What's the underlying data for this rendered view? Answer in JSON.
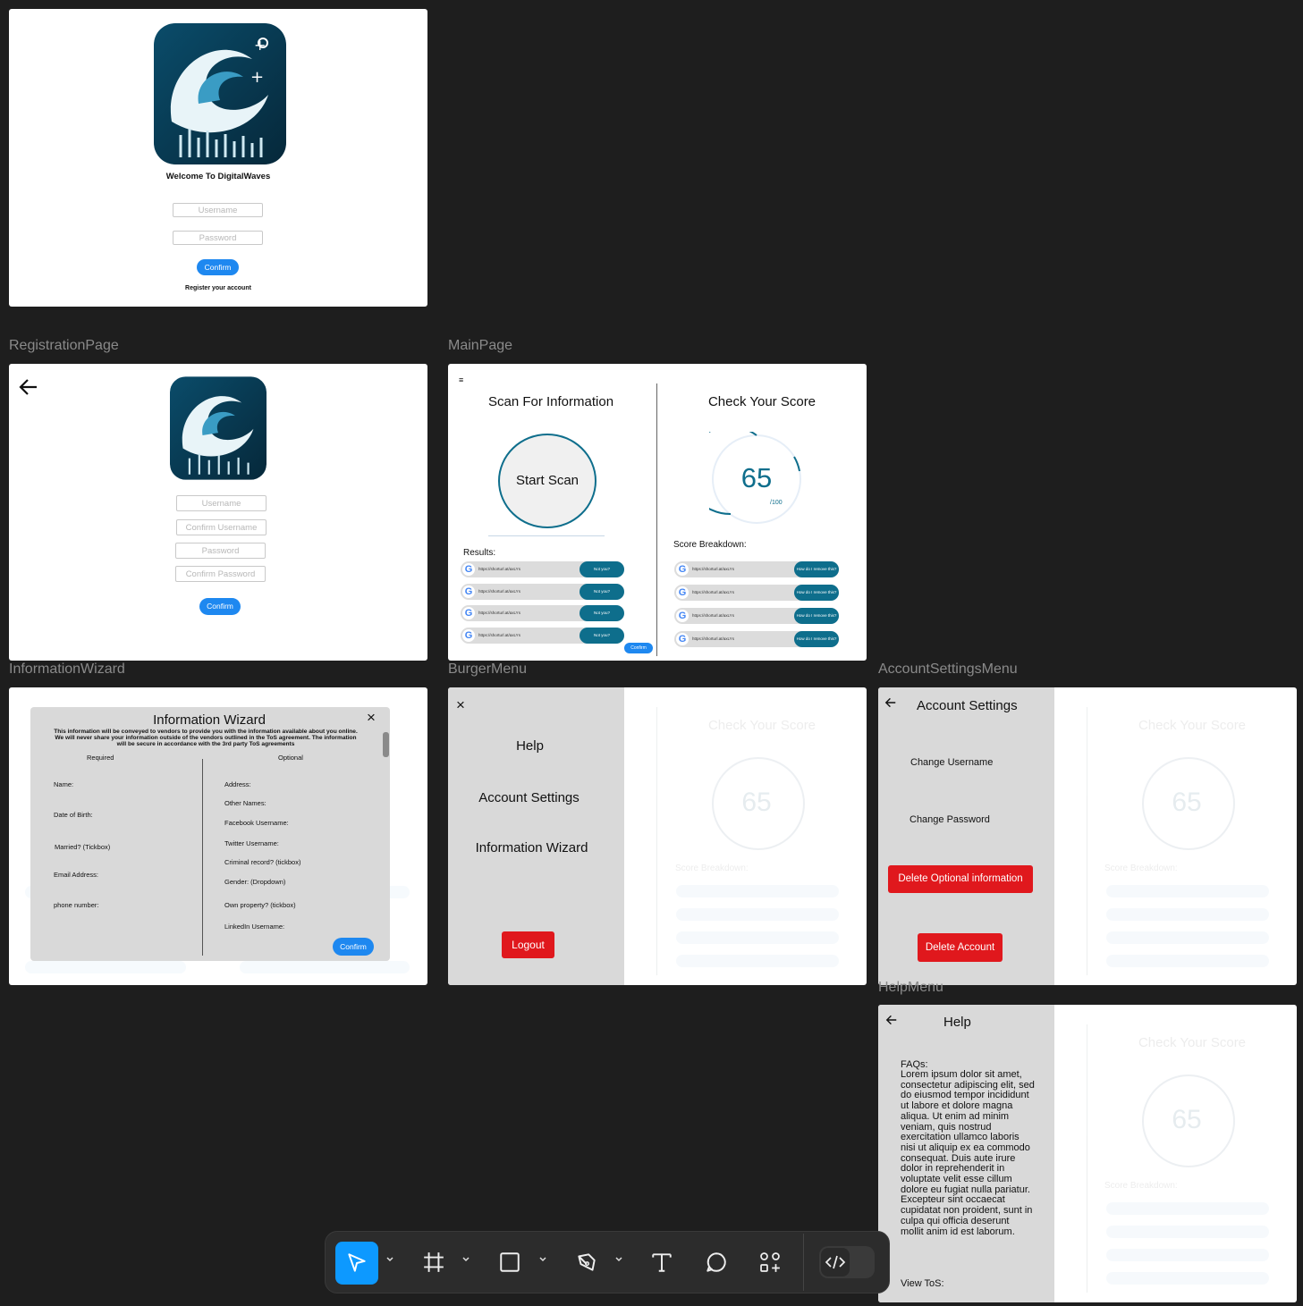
{
  "frames": {
    "login": {
      "welcome": "Welcome To DigitalWaves",
      "username_placeholder": "Username",
      "password_placeholder": "Password",
      "confirm": "Confirm",
      "register": "Register your account"
    },
    "registration": {
      "label": "RegistrationPage",
      "username": "Username",
      "confirm_username": "Confirm Username",
      "password": "Password",
      "confirm_password": "Confirm Password",
      "confirm": "Confirm"
    },
    "main": {
      "label": "MainPage",
      "menu_glyph": "≡",
      "scan_title": "Scan For Information",
      "start_scan": "Start Scan",
      "results_label": "Results:",
      "results": [
        {
          "url": "https://shorturl.at/axLYs",
          "action": "Not you?"
        },
        {
          "url": "https://shorturl.at/axLYs",
          "action": "Not you?"
        },
        {
          "url": "https://shorturl.at/axLYs",
          "action": "Not you?"
        },
        {
          "url": "https://shorturl.at/axLYs",
          "action": "Not you?"
        }
      ],
      "confirm": "Confirm",
      "score_title": "Check Your Score",
      "score": "65",
      "score_max": "/100",
      "breakdown_label": "Score Breakdown:",
      "breakdown": [
        {
          "url": "https://shorturl.at/axLYs",
          "action": "How do I remove this?"
        },
        {
          "url": "https://shorturl.at/axLYs",
          "action": "How do I remove this?"
        },
        {
          "url": "https://shorturl.at/axLYs",
          "action": "How do I remove this?"
        },
        {
          "url": "https://shorturl.at/axLYs",
          "action": "How do I remove this?"
        }
      ]
    },
    "wizard": {
      "label": "InformationWizard",
      "title": "Information Wizard",
      "close": "×",
      "description": "This information will be conveyed to vendors to provide you with the information available about you online. We will never share your information outside of the vendors outlined in the ToS agreement. The information will be secure in accordance with the 3rd party ToS agreements",
      "required_header": "Required",
      "optional_header": "Optional",
      "required_fields": [
        "Name:",
        "Date of Birth:",
        "Married? (Tickbox)",
        "Email Address:",
        "phone number:"
      ],
      "optional_fields": [
        "Address:",
        "Other Names:",
        "Facebook Username:",
        "Twitter Username:",
        "Criminal record? (tickbox)",
        "Gender: (Dropdown)",
        "Own property? (tickbox)",
        "LinkedIn Username:"
      ],
      "confirm": "Confirm"
    },
    "burger": {
      "label": "BurgerMenu",
      "close": "×",
      "items": [
        "Help",
        "Account Settings",
        "Information Wizard"
      ],
      "logout": "Logout"
    },
    "account": {
      "label": "AccountSettingsMenu",
      "title": "Account Settings",
      "change_username": "Change Username",
      "change_password": "Change Password",
      "delete_optional": "Delete Optional information",
      "delete_account": "Delete Account"
    },
    "help": {
      "label": "HelpMenu",
      "title": "Help",
      "faqs_label": "FAQs:",
      "faqs_text": "Lorem ipsum dolor sit amet, consectetur adipiscing elit, sed do eiusmod tempor incididunt ut labore et dolore magna aliqua. Ut enim ad minim veniam, quis nostrud exercitation ullamco laboris nisi ut aliquip ex ea commodo consequat. Duis aute irure dolor in reprehenderit in voluptate velit esse cillum dolore eu fugiat nulla pariatur. Excepteur sint occaecat cupidatat non proident, sunt in culpa qui officia deserunt mollit anim id est laborum.",
      "view_tos": "View ToS:"
    }
  },
  "colors": {
    "canvas": "#1e1e1e",
    "accent_blue": "#1e88f0",
    "teal": "#0e6e8c",
    "danger_red": "#e0181d",
    "panel_grey": "#d9d9d9"
  },
  "toolbar": {
    "tools": [
      "move-tool-icon",
      "frame-tool-icon",
      "rectangle-tool-icon",
      "pen-tool-icon",
      "text-tool-icon",
      "comment-tool-icon",
      "components-tool-icon",
      "dev-mode-icon"
    ],
    "active": "move-tool-icon"
  }
}
